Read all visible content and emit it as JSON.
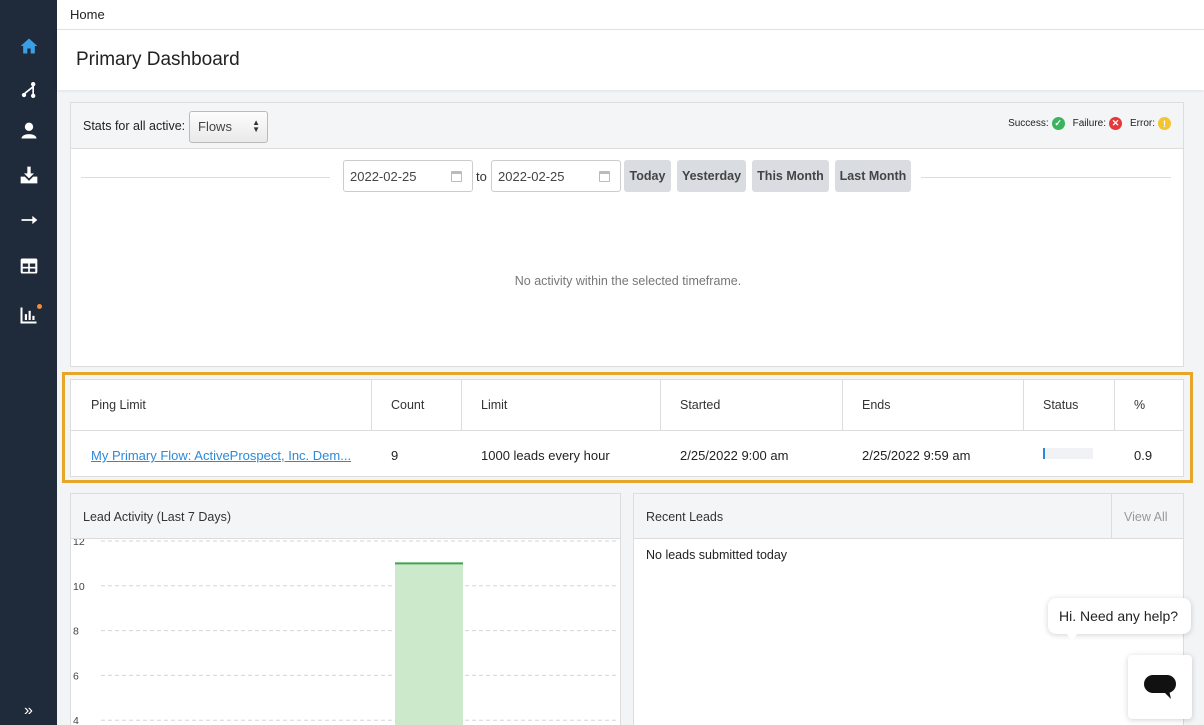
{
  "breadcrumb": "Home",
  "page_title": "Primary Dashboard",
  "sidebar": {
    "items": [
      {
        "name": "home-icon",
        "active": true
      },
      {
        "name": "flows-icon"
      },
      {
        "name": "contacts-icon"
      },
      {
        "name": "import-icon"
      },
      {
        "name": "arrow-right-icon"
      },
      {
        "name": "table-icon"
      },
      {
        "name": "reports-icon",
        "badge": true
      }
    ],
    "expand_label": "»"
  },
  "stats": {
    "label": "Stats for all active:",
    "select_value": "Flows",
    "legend": {
      "success": "Success:",
      "failure": "Failure:",
      "error": "Error:",
      "success_color": "#3bb45e",
      "failure_color": "#e23a3a",
      "error_color": "#f2c531"
    },
    "start_date": "2022-02-25",
    "end_date": "2022-02-25",
    "to_label": "to",
    "buttons": {
      "today": "Today",
      "yesterday": "Yesterday",
      "this_month": "This Month",
      "last_month": "Last Month"
    },
    "empty_message": "No activity within the selected timeframe."
  },
  "ping_table": {
    "headers": [
      "Ping Limit",
      "Count",
      "Limit",
      "Started",
      "Ends",
      "Status",
      "%"
    ],
    "row": {
      "flow": "My Primary Flow: ActiveProspect, Inc. Dem...",
      "count": "9",
      "limit": "1000 leads every hour",
      "started": "2/25/2022 9:00 am",
      "ends": "2/25/2022 9:59 am",
      "status_fraction": 0.009,
      "percent": "0.9"
    }
  },
  "lead_activity": {
    "title": "Lead Activity (Last 7 Days)"
  },
  "chart_data": {
    "type": "bar",
    "title": "Lead Activity (Last 7 Days)",
    "ylim": [
      0,
      12
    ],
    "yticks": [
      "12",
      "10",
      "8",
      "6",
      "4"
    ],
    "categories": [
      "",
      "",
      "",
      "",
      "",
      "",
      ""
    ],
    "values": [
      0,
      0,
      0,
      0,
      11,
      0,
      0
    ],
    "bar_color": "#cde9cc",
    "bar_edge_color": "#3fa34d",
    "grid": true
  },
  "recent_leads": {
    "title": "Recent Leads",
    "view_all": "View All",
    "empty_message": "No leads submitted today"
  },
  "chat": {
    "bubble": "Hi. Need any help?"
  },
  "colors": {
    "sidebar_bg": "#1f2a3a",
    "active_icon": "#3aa0e6",
    "highlight_outline": "#e6a62a",
    "link": "#2b8ad8"
  }
}
